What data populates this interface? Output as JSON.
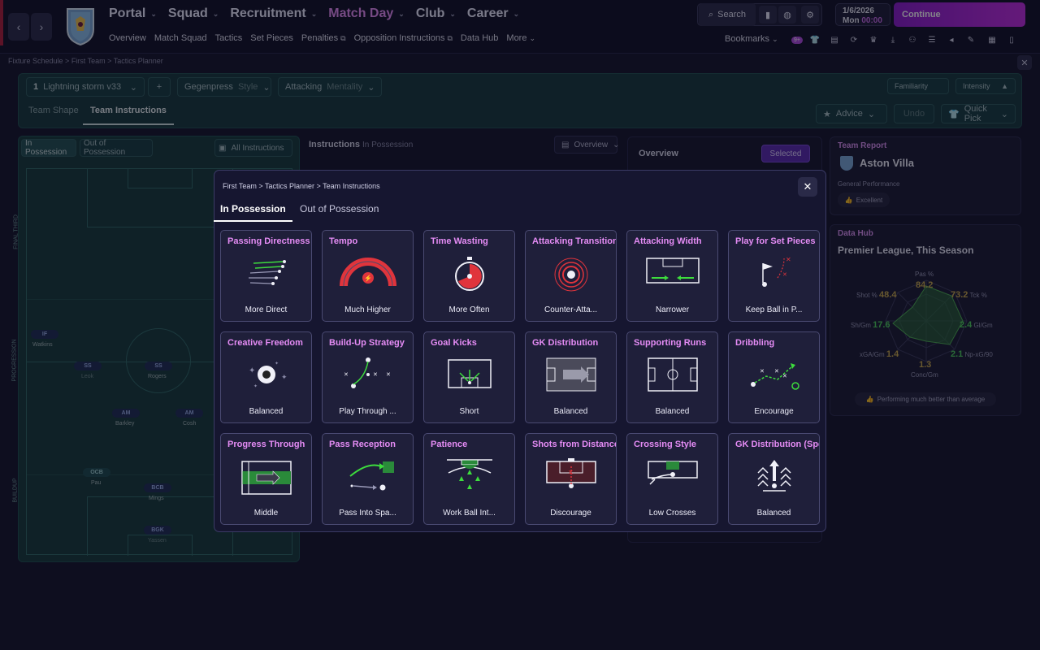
{
  "topbar": {
    "nav": [
      {
        "label": "Portal"
      },
      {
        "label": "Squad"
      },
      {
        "label": "Recruitment"
      },
      {
        "label": "Match Day"
      },
      {
        "label": "Club"
      },
      {
        "label": "Career"
      }
    ],
    "subnav": [
      "Overview",
      "Match Squad",
      "Tactics",
      "Set Pieces",
      "Penalties",
      "Opposition Instructions",
      "Data Hub",
      "More"
    ],
    "search_label": "Search",
    "date": "1/6/2026",
    "day": "Mon",
    "time": "00:00",
    "continue_label": "Continue",
    "bookmarks_label": "Bookmarks",
    "badge": "9+"
  },
  "breadcrumb": [
    "Fixture Schedule",
    "First Team",
    "Tactics Planner"
  ],
  "tactics": {
    "num": "1",
    "name": "Lightning storm v33",
    "style_value": "Gegenpress",
    "style_label": "Style",
    "mentality_value": "Attacking",
    "mentality_label": "Mentality",
    "familiarity": "Familiarity",
    "intensity": "Intensity",
    "tabs": [
      "Team Shape",
      "Team Instructions"
    ],
    "advice": "Advice",
    "undo": "Undo",
    "quick_pick": "Quick Pick"
  },
  "pitch": {
    "tabs": [
      "In Possession",
      "Out of Possession"
    ],
    "all_instructions": "All Instructions",
    "zones": [
      "FINAL THIRD",
      "PROGRESSION",
      "BUILDUP"
    ],
    "players": [
      {
        "pos": "IF",
        "name": "Watkins"
      },
      {
        "pos": "SS",
        "name": "Leok"
      },
      {
        "pos": "SS",
        "name": "Rogers"
      },
      {
        "pos": "AM",
        "name": "Barkley"
      },
      {
        "pos": "AM",
        "name": "Cosh"
      },
      {
        "pos": "OCB",
        "name": "Pau"
      },
      {
        "pos": "BCB",
        "name": "Mings"
      },
      {
        "pos": "BGK",
        "name": "Yassen"
      }
    ]
  },
  "middle": {
    "title": "Instructions",
    "subtitle": "In Possession",
    "dropdown": "Overview"
  },
  "overview": {
    "title": "Overview",
    "selected": "Selected"
  },
  "team_report": {
    "title": "Team Report",
    "team": "Aston Villa",
    "gp_label": "General Performance",
    "gp_value": "Excellent"
  },
  "data_hub": {
    "title": "Data Hub",
    "subtitle": "Premier League, This Season",
    "stats": [
      {
        "label": "Pas %",
        "value": "84.2"
      },
      {
        "label": "Tck %",
        "value": "73.2"
      },
      {
        "label": "Gl/Gm",
        "value": "2.4"
      },
      {
        "label": "Np-xG/90",
        "value": "2.1"
      },
      {
        "label": "Conc/Gm",
        "value": "1.3"
      },
      {
        "label": "xGA/Gm",
        "value": "1.4"
      },
      {
        "label": "Sh/Gm",
        "value": "17.6"
      },
      {
        "label": "Shot %",
        "value": "48.4"
      }
    ],
    "footer": "Performing much better than average"
  },
  "modal": {
    "breadcrumb": [
      "First Team",
      "Tactics Planner",
      "Team Instructions"
    ],
    "tabs": [
      "In Possession",
      "Out of Possession"
    ],
    "tiles": [
      {
        "title": "Passing Directness",
        "value": "More Direct",
        "icon": "passing-directness"
      },
      {
        "title": "Tempo",
        "value": "Much Higher",
        "icon": "tempo"
      },
      {
        "title": "Time Wasting",
        "value": "More Often",
        "icon": "time-wasting"
      },
      {
        "title": "Attacking Transition",
        "value": "Counter-Atta...",
        "icon": "attacking-transition"
      },
      {
        "title": "Attacking Width",
        "value": "Narrower",
        "icon": "attacking-width"
      },
      {
        "title": "Play for Set Pieces",
        "value": "Keep Ball in P...",
        "icon": "set-pieces"
      },
      {
        "title": "Creative Freedom",
        "value": "Balanced",
        "icon": "creative-freedom"
      },
      {
        "title": "Build-Up Strategy",
        "value": "Play Through ...",
        "icon": "build-up"
      },
      {
        "title": "Goal Kicks",
        "value": "Short",
        "icon": "goal-kicks"
      },
      {
        "title": "GK Distribution",
        "value": "Balanced",
        "icon": "gk-distribution"
      },
      {
        "title": "Supporting Runs",
        "value": "Balanced",
        "icon": "supporting-runs"
      },
      {
        "title": "Dribbling",
        "value": "Encourage",
        "icon": "dribbling"
      },
      {
        "title": "Progress Through",
        "value": "Middle",
        "icon": "progress-through"
      },
      {
        "title": "Pass Reception",
        "value": "Pass Into Spa...",
        "icon": "pass-reception"
      },
      {
        "title": "Patience",
        "value": "Work Ball Int...",
        "icon": "patience"
      },
      {
        "title": "Shots from Distance",
        "value": "Discourage",
        "icon": "shots-distance"
      },
      {
        "title": "Crossing Style",
        "value": "Low Crosses",
        "icon": "crossing-style"
      },
      {
        "title": "GK Distribution (Speed",
        "value": "Balanced",
        "icon": "gk-speed"
      }
    ]
  },
  "colors": {
    "accent": "#e58cf5",
    "continue": "#b52bdc",
    "green": "#3ddc3d",
    "red": "#e0343c"
  }
}
